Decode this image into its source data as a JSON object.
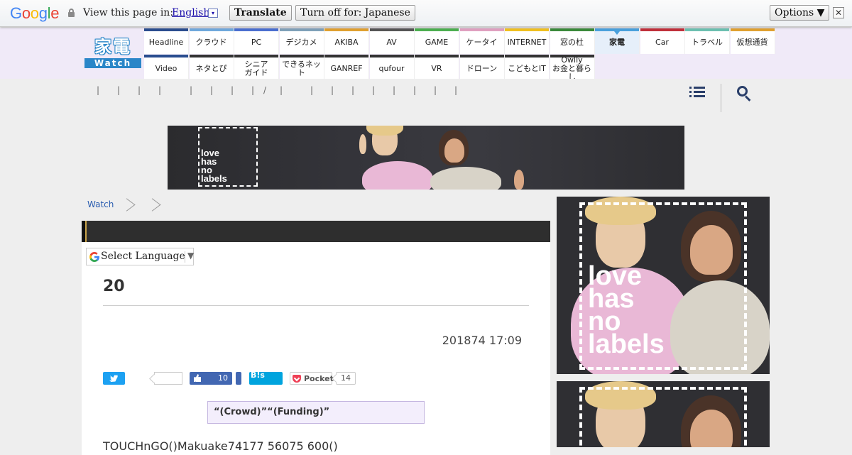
{
  "translate_bar": {
    "logo": "Google",
    "prompt": "View this page in:",
    "language": "English",
    "language_dropdown_icon": "▾",
    "translate_button": "Translate",
    "turn_off_button": "Turn off for: Japanese",
    "options_button": "Options ▼",
    "close_icon": "✕"
  },
  "site": {
    "logo_main": "家電",
    "logo_sub": "Watch"
  },
  "nav": {
    "row1": [
      {
        "label": "Headline",
        "color": "#2a4d8f"
      },
      {
        "label": "クラウド",
        "color": "#6fa8dc"
      },
      {
        "label": "PC",
        "color": "#4a6fd0"
      },
      {
        "label": "デジカメ",
        "color": "#7fa0b8"
      },
      {
        "label": "AKIBA",
        "color": "#e0a030"
      },
      {
        "label": "AV",
        "color": "#555555"
      },
      {
        "label": "GAME",
        "color": "#4caf50"
      },
      {
        "label": "ケータイ",
        "color": "#e0a0c0"
      },
      {
        "label": "INTERNET",
        "color": "#f0c020"
      },
      {
        "label": "窓の杜",
        "color": "#3a8a3a"
      },
      {
        "label": "家電",
        "color": "#4aa0dc",
        "active": true
      },
      {
        "label": "Car",
        "color": "#c0303a"
      },
      {
        "label": "トラベル",
        "color": "#6cc0b0"
      },
      {
        "label": "仮想通貨",
        "color": "#e0a030"
      }
    ],
    "row2": [
      {
        "label": "Video",
        "color": "#2a4d8f"
      },
      {
        "label": "ネタとぴ",
        "color": "#333333"
      },
      {
        "label": "シニア\nガイド",
        "color": "#333333"
      },
      {
        "label": "できるネット",
        "color": "#333333"
      },
      {
        "label": "GANREF",
        "color": "#333333"
      },
      {
        "label": "qufour",
        "color": "#333333"
      },
      {
        "label": "VR",
        "color": "#333333"
      },
      {
        "label": "ドローン",
        "color": "#333333"
      },
      {
        "label": "こどもとIT",
        "color": "#333333"
      },
      {
        "label": "Owlly\nお金と暮らし",
        "color": "#333333"
      }
    ]
  },
  "subnav": {
    "separators": [
      "|",
      "|",
      "|",
      "|",
      "|",
      "|",
      "|",
      "|",
      "/",
      "|",
      "|",
      "|",
      "|",
      "|",
      "|",
      "|",
      "|",
      "|"
    ],
    "menu_icon": "list-menu-icon",
    "search_icon": "search-icon"
  },
  "ad_banner": {
    "text_lines": [
      "love",
      "has",
      "no",
      "labels"
    ]
  },
  "breadcrumb": {
    "items": [
      "Watch",
      "",
      ""
    ]
  },
  "article": {
    "language_select": "Select Language",
    "language_select_arrow": "▼",
    "title": "20",
    "date": "201874 17:09",
    "share": {
      "twitter_count": "",
      "facebook_count": "10",
      "hatena_label": "B!s",
      "pocket_label": "Pocket",
      "pocket_count": "14"
    },
    "caption": "“(Crowd)”“(Funding)”",
    "body": "TOUCHnGO()Makuake74177 56075 600()"
  },
  "sidebar_ad": {
    "text_lines": [
      "love",
      "has",
      "no",
      "labels"
    ]
  }
}
